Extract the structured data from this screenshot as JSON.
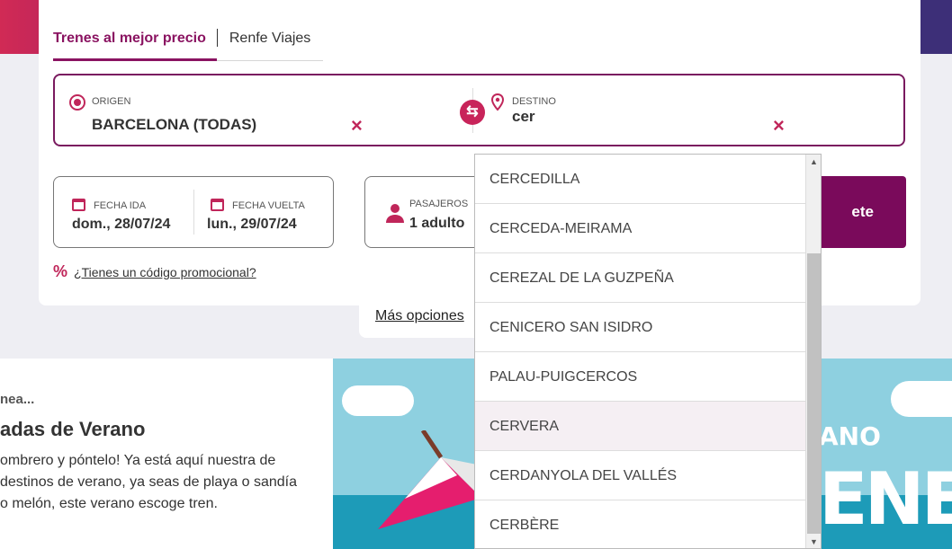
{
  "tabs": [
    {
      "label": "Trenes al mejor precio"
    },
    {
      "label": "Renfe Viajes"
    }
  ],
  "origin": {
    "label": "ORIGEN",
    "value": "BARCELONA (TODAS)"
  },
  "destination": {
    "label": "DESTINO",
    "value": "cer"
  },
  "dates": {
    "outbound_label": "FECHA IDA",
    "outbound_value": "dom., 28/07/24",
    "return_label": "FECHA VUELTA",
    "return_value": "lun., 29/07/24"
  },
  "passengers": {
    "label": "PASAJEROS",
    "value": "1 adulto"
  },
  "search_button_label": "ete",
  "promo": {
    "symbol": "%",
    "link": "¿Tienes un código promocional?"
  },
  "more_options": "Más opciones",
  "dropdown": {
    "items": [
      {
        "label": "CERCEDILLA"
      },
      {
        "label": "CERCEDA-MEIRAMA"
      },
      {
        "label": "CEREZAL DE LA GUZPEÑA"
      },
      {
        "label": "CENICERO SAN ISIDRO"
      },
      {
        "label": "PALAU-PUIGCERCOS"
      },
      {
        "label": "CERVERA"
      },
      {
        "label": "CERDANYOLA DEL VALLÉS"
      },
      {
        "label": "CERBÈRE"
      }
    ],
    "highlighted": "CERVERA"
  },
  "promo_section": {
    "kicker": "nea...",
    "title": "adas de Verano",
    "body": "ombrero y póntelo! Ya está aquí nuestra de destinos de verano, ya seas de playa o sandía o melón, este verano escoge tren."
  },
  "promo_image": {
    "text1": "ANO",
    "text2": "ENEA"
  },
  "colors": {
    "brand": "#8a1361",
    "accent": "#c0265a",
    "button": "#7a0a5b"
  }
}
